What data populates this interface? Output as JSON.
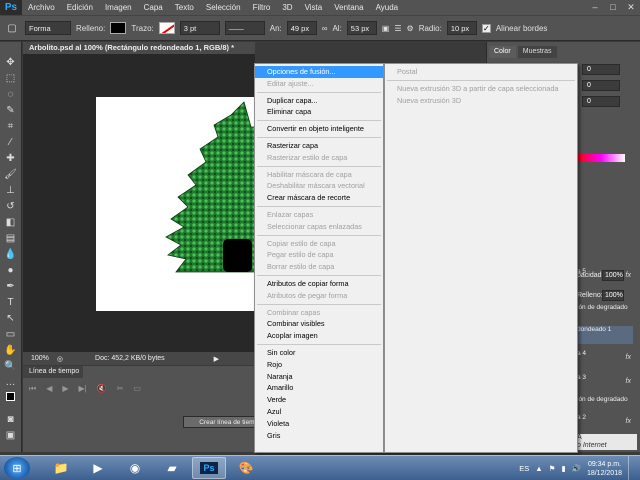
{
  "menubar": {
    "logo": "Ps",
    "items": [
      "Archivo",
      "Edición",
      "Imagen",
      "Capa",
      "Texto",
      "Selección",
      "Filtro",
      "3D",
      "Vista",
      "Ventana",
      "Ayuda"
    ]
  },
  "options_bar": {
    "shape_mode": "Forma",
    "fill_label": "Relleno:",
    "stroke_label": "Trazo:",
    "stroke_size": "3 pt",
    "width_label": "An:",
    "width_value": "49 px",
    "height_label": "Al:",
    "height_value": "53 px",
    "radius_label": "Radio:",
    "radius_value": "10 px",
    "align_edges_label": "Alinear bordes"
  },
  "document": {
    "tab_title": "Arbolito.psd al 100% (Rectángulo redondeado 1, RGB/8) *",
    "zoom": "100%",
    "doc_info": "Doc: 452,2 KB/0 bytes"
  },
  "timeline": {
    "tab_label": "Línea de tiempo",
    "create_button": "Crear línea de tiempo"
  },
  "right_panel": {
    "tabs": [
      "Color",
      "Muestras"
    ],
    "color_values": [
      "0",
      "0",
      "0"
    ],
    "opacity_label": "pacidad:",
    "opacity_value": "100%",
    "fill_label": "Relleno:",
    "fill_value": "100%",
    "layers": [
      {
        "label": "a 5",
        "fx": "fx"
      },
      {
        "label": "ión de degradado",
        "fx": ""
      },
      {
        "label": "dondeado 1",
        "fx": ""
      },
      {
        "label": "a 4",
        "fx": "fx"
      },
      {
        "label": "a 3",
        "fx": "fx"
      },
      {
        "label": "ión de degradado",
        "fx": ""
      },
      {
        "label": "a 2",
        "fx": "fx"
      }
    ],
    "footer_text": "A",
    "footer_text2": "o Internet"
  },
  "context_menu": {
    "groups": [
      [
        {
          "label": "Opciones de fusión...",
          "state": "highlighted"
        },
        {
          "label": "Editar ajuste...",
          "state": "disabled"
        }
      ],
      [
        {
          "label": "Duplicar capa...",
          "state": ""
        },
        {
          "label": "Eliminar capa",
          "state": ""
        }
      ],
      [
        {
          "label": "Convertir en objeto inteligente",
          "state": ""
        }
      ],
      [
        {
          "label": "Rasterizar capa",
          "state": ""
        },
        {
          "label": "Rasterizar estilo de capa",
          "state": "disabled"
        }
      ],
      [
        {
          "label": "Habilitar máscara de capa",
          "state": "disabled"
        },
        {
          "label": "Deshabilitar máscara vectorial",
          "state": "disabled"
        },
        {
          "label": "Crear máscara de recorte",
          "state": ""
        }
      ],
      [
        {
          "label": "Enlazar capas",
          "state": "disabled"
        },
        {
          "label": "Seleccionar capas enlazadas",
          "state": "disabled"
        }
      ],
      [
        {
          "label": "Copiar estilo de capa",
          "state": "disabled"
        },
        {
          "label": "Pegar estilo de capa",
          "state": "disabled"
        },
        {
          "label": "Borrar estilo de capa",
          "state": "disabled"
        }
      ],
      [
        {
          "label": "Atributos de copiar forma",
          "state": ""
        },
        {
          "label": "Atributos de pegar forma",
          "state": "disabled"
        }
      ],
      [
        {
          "label": "Combinar capas",
          "state": "disabled"
        },
        {
          "label": "Combinar visibles",
          "state": ""
        },
        {
          "label": "Acoplar imagen",
          "state": ""
        }
      ],
      [
        {
          "label": "Sin color",
          "state": ""
        },
        {
          "label": "Rojo",
          "state": ""
        },
        {
          "label": "Naranja",
          "state": ""
        },
        {
          "label": "Amarillo",
          "state": ""
        },
        {
          "label": "Verde",
          "state": ""
        },
        {
          "label": "Azul",
          "state": ""
        },
        {
          "label": "Violeta",
          "state": ""
        },
        {
          "label": "Gris",
          "state": ""
        }
      ]
    ]
  },
  "submenu": {
    "groups": [
      [
        {
          "label": "Postal",
          "state": "disabled"
        }
      ],
      [
        {
          "label": "Nueva extrusión 3D a partir de capa seleccionada",
          "state": "disabled"
        },
        {
          "label": "Nueva extrusión 3D",
          "state": "disabled"
        }
      ]
    ]
  },
  "taskbar": {
    "language": "ES",
    "time": "09:34 p.m.",
    "date": "18/12/2018",
    "apps": [
      "explorer",
      "media-player",
      "chrome",
      "app-4",
      "photoshop",
      "paint"
    ]
  },
  "colors": {
    "highlight": "#3399ff",
    "ui_dark": "#535353",
    "canvas_bg": "#282828"
  }
}
